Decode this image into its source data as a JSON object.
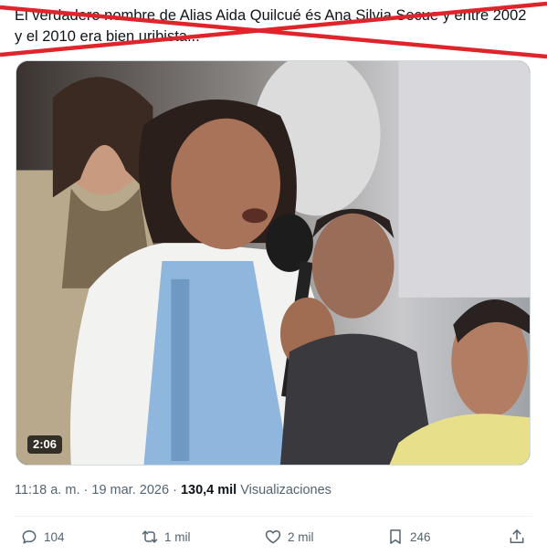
{
  "tweet": {
    "text": "El verdadero nombre de  Alias Aida Quilcué és Ana Silvia Secue y entre 2002 y el 2010 era bien uribista...",
    "video_duration": "2:06",
    "time": "11:18 a. m.",
    "separator": "·",
    "date": "19 mar. 2026",
    "views_count": "130,4 mil",
    "views_label": "Visualizaciones"
  },
  "actions": {
    "replies": "104",
    "retweets": "1 mil",
    "likes": "2 mil",
    "bookmarks": "246"
  },
  "icons": {
    "reply": "reply-icon",
    "retweet": "retweet-icon",
    "like": "heart-icon",
    "bookmark": "bookmark-icon",
    "share": "share-icon"
  },
  "colors": {
    "cross": "#e0242b",
    "text": "#0f1419",
    "secondary": "#536471"
  }
}
